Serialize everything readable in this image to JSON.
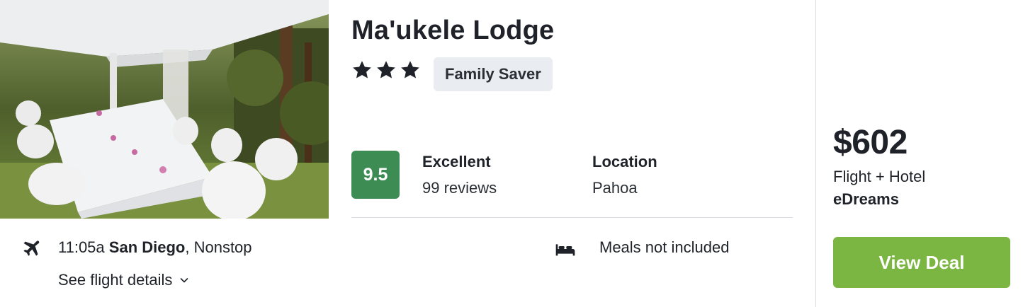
{
  "hotel": {
    "name": "Ma'ukele Lodge",
    "star_rating": 3,
    "badge": "Family Saver"
  },
  "rating": {
    "score": "9.5",
    "label": "Excellent",
    "reviews": "99 reviews",
    "score_color": "#3d8c54"
  },
  "location": {
    "label": "Location",
    "value": "Pahoa"
  },
  "flight": {
    "time": "11:05a",
    "origin": "San Diego",
    "stops": ", Nonstop",
    "details_link": "See flight details",
    "icon": "plane-icon"
  },
  "meals": {
    "text": "Meals not included",
    "icon": "bed-icon"
  },
  "deal": {
    "price": "$602",
    "package": "Flight + Hotel",
    "provider": "eDreams",
    "button_label": "View Deal",
    "button_color": "#7bb542"
  }
}
